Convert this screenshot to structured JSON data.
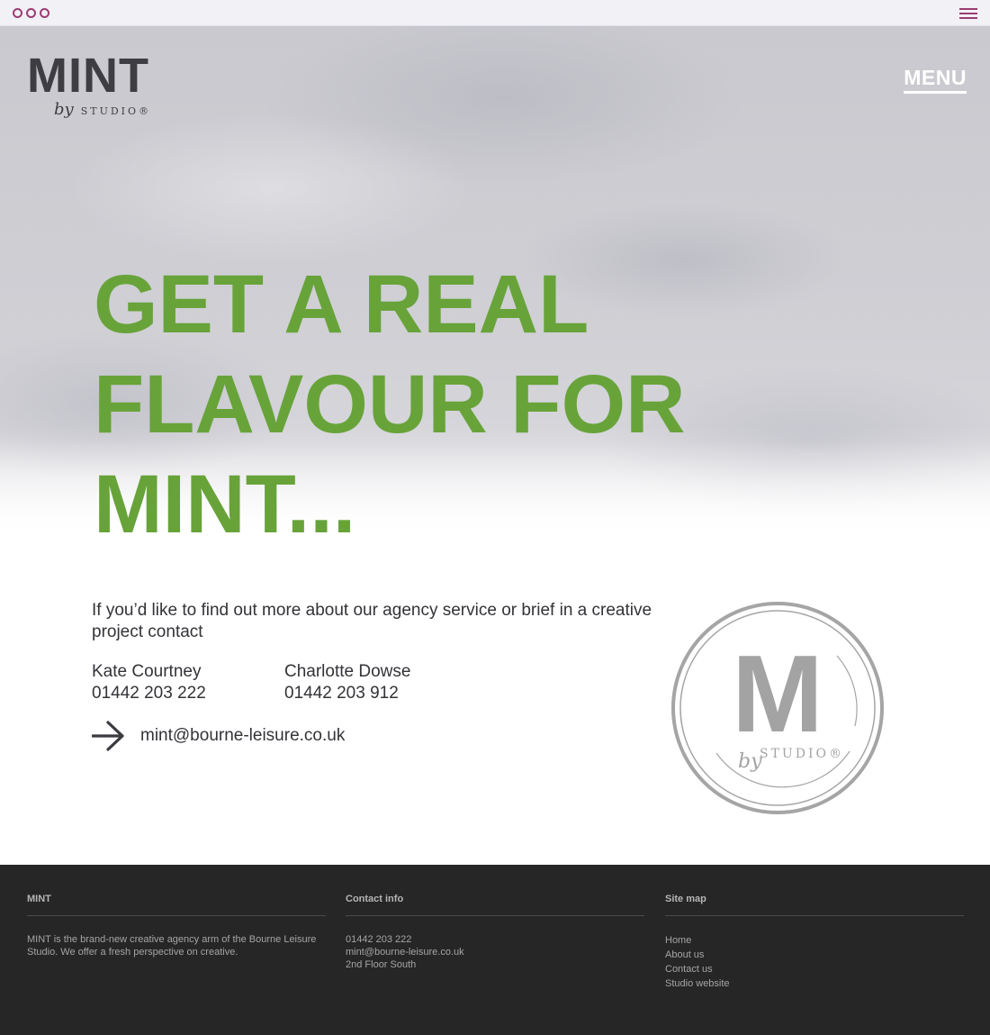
{
  "chrome": {
    "dots_icon": "window-dots-icon",
    "menu_icon": "hamburger-icon",
    "accent": "#9b3d72"
  },
  "header": {
    "logo": {
      "word": "MINT",
      "by": "by",
      "studio": "STUDIO®"
    },
    "menu_label": "MENU"
  },
  "hero": {
    "headline_lines": [
      "GET A REAL",
      "FLAVOUR FOR",
      "MINT..."
    ],
    "headline_color": "#68a33a"
  },
  "contact": {
    "intro": "If you’d like to find out more about our agency service or brief in a creative project contact",
    "people": [
      {
        "name": "Kate Courtney",
        "phone": "01442 203 222"
      },
      {
        "name": "Charlotte Dowse",
        "phone": "01442 203 912"
      }
    ],
    "email_icon": "arrow-right-icon",
    "email": "mint@bourne-leisure.co.uk"
  },
  "badge": {
    "letter": "M",
    "by": "by",
    "studio": "STUDIO®"
  },
  "footer": {
    "about": {
      "title": "MINT",
      "text": "MINT is the brand-new creative agency arm of the Bourne Leisure Studio. We offer a fresh perspective on creative."
    },
    "contact_info": {
      "title": "Contact info",
      "lines": [
        "01442 203 222",
        "mint@bourne-leisure.co.uk",
        "2nd Floor South"
      ]
    },
    "site_map": {
      "title": "Site map",
      "links": [
        "Home",
        "About us",
        "Contact us",
        "Studio website"
      ]
    }
  }
}
